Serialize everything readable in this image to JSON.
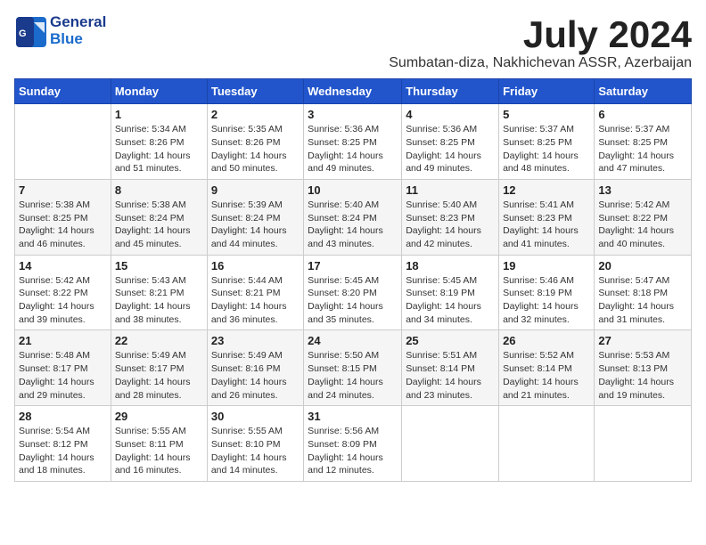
{
  "header": {
    "logo_line1": "General",
    "logo_line2": "Blue",
    "month": "July 2024",
    "location": "Sumbatan-diza, Nakhichevan ASSR, Azerbaijan"
  },
  "weekdays": [
    "Sunday",
    "Monday",
    "Tuesday",
    "Wednesday",
    "Thursday",
    "Friday",
    "Saturday"
  ],
  "weeks": [
    [
      {
        "day": "",
        "info": ""
      },
      {
        "day": "1",
        "info": "Sunrise: 5:34 AM\nSunset: 8:26 PM\nDaylight: 14 hours\nand 51 minutes."
      },
      {
        "day": "2",
        "info": "Sunrise: 5:35 AM\nSunset: 8:26 PM\nDaylight: 14 hours\nand 50 minutes."
      },
      {
        "day": "3",
        "info": "Sunrise: 5:36 AM\nSunset: 8:25 PM\nDaylight: 14 hours\nand 49 minutes."
      },
      {
        "day": "4",
        "info": "Sunrise: 5:36 AM\nSunset: 8:25 PM\nDaylight: 14 hours\nand 49 minutes."
      },
      {
        "day": "5",
        "info": "Sunrise: 5:37 AM\nSunset: 8:25 PM\nDaylight: 14 hours\nand 48 minutes."
      },
      {
        "day": "6",
        "info": "Sunrise: 5:37 AM\nSunset: 8:25 PM\nDaylight: 14 hours\nand 47 minutes."
      }
    ],
    [
      {
        "day": "7",
        "info": "Sunrise: 5:38 AM\nSunset: 8:25 PM\nDaylight: 14 hours\nand 46 minutes."
      },
      {
        "day": "8",
        "info": "Sunrise: 5:38 AM\nSunset: 8:24 PM\nDaylight: 14 hours\nand 45 minutes."
      },
      {
        "day": "9",
        "info": "Sunrise: 5:39 AM\nSunset: 8:24 PM\nDaylight: 14 hours\nand 44 minutes."
      },
      {
        "day": "10",
        "info": "Sunrise: 5:40 AM\nSunset: 8:24 PM\nDaylight: 14 hours\nand 43 minutes."
      },
      {
        "day": "11",
        "info": "Sunrise: 5:40 AM\nSunset: 8:23 PM\nDaylight: 14 hours\nand 42 minutes."
      },
      {
        "day": "12",
        "info": "Sunrise: 5:41 AM\nSunset: 8:23 PM\nDaylight: 14 hours\nand 41 minutes."
      },
      {
        "day": "13",
        "info": "Sunrise: 5:42 AM\nSunset: 8:22 PM\nDaylight: 14 hours\nand 40 minutes."
      }
    ],
    [
      {
        "day": "14",
        "info": "Sunrise: 5:42 AM\nSunset: 8:22 PM\nDaylight: 14 hours\nand 39 minutes."
      },
      {
        "day": "15",
        "info": "Sunrise: 5:43 AM\nSunset: 8:21 PM\nDaylight: 14 hours\nand 38 minutes."
      },
      {
        "day": "16",
        "info": "Sunrise: 5:44 AM\nSunset: 8:21 PM\nDaylight: 14 hours\nand 36 minutes."
      },
      {
        "day": "17",
        "info": "Sunrise: 5:45 AM\nSunset: 8:20 PM\nDaylight: 14 hours\nand 35 minutes."
      },
      {
        "day": "18",
        "info": "Sunrise: 5:45 AM\nSunset: 8:19 PM\nDaylight: 14 hours\nand 34 minutes."
      },
      {
        "day": "19",
        "info": "Sunrise: 5:46 AM\nSunset: 8:19 PM\nDaylight: 14 hours\nand 32 minutes."
      },
      {
        "day": "20",
        "info": "Sunrise: 5:47 AM\nSunset: 8:18 PM\nDaylight: 14 hours\nand 31 minutes."
      }
    ],
    [
      {
        "day": "21",
        "info": "Sunrise: 5:48 AM\nSunset: 8:17 PM\nDaylight: 14 hours\nand 29 minutes."
      },
      {
        "day": "22",
        "info": "Sunrise: 5:49 AM\nSunset: 8:17 PM\nDaylight: 14 hours\nand 28 minutes."
      },
      {
        "day": "23",
        "info": "Sunrise: 5:49 AM\nSunset: 8:16 PM\nDaylight: 14 hours\nand 26 minutes."
      },
      {
        "day": "24",
        "info": "Sunrise: 5:50 AM\nSunset: 8:15 PM\nDaylight: 14 hours\nand 24 minutes."
      },
      {
        "day": "25",
        "info": "Sunrise: 5:51 AM\nSunset: 8:14 PM\nDaylight: 14 hours\nand 23 minutes."
      },
      {
        "day": "26",
        "info": "Sunrise: 5:52 AM\nSunset: 8:14 PM\nDaylight: 14 hours\nand 21 minutes."
      },
      {
        "day": "27",
        "info": "Sunrise: 5:53 AM\nSunset: 8:13 PM\nDaylight: 14 hours\nand 19 minutes."
      }
    ],
    [
      {
        "day": "28",
        "info": "Sunrise: 5:54 AM\nSunset: 8:12 PM\nDaylight: 14 hours\nand 18 minutes."
      },
      {
        "day": "29",
        "info": "Sunrise: 5:55 AM\nSunset: 8:11 PM\nDaylight: 14 hours\nand 16 minutes."
      },
      {
        "day": "30",
        "info": "Sunrise: 5:55 AM\nSunset: 8:10 PM\nDaylight: 14 hours\nand 14 minutes."
      },
      {
        "day": "31",
        "info": "Sunrise: 5:56 AM\nSunset: 8:09 PM\nDaylight: 14 hours\nand 12 minutes."
      },
      {
        "day": "",
        "info": ""
      },
      {
        "day": "",
        "info": ""
      },
      {
        "day": "",
        "info": ""
      }
    ]
  ]
}
